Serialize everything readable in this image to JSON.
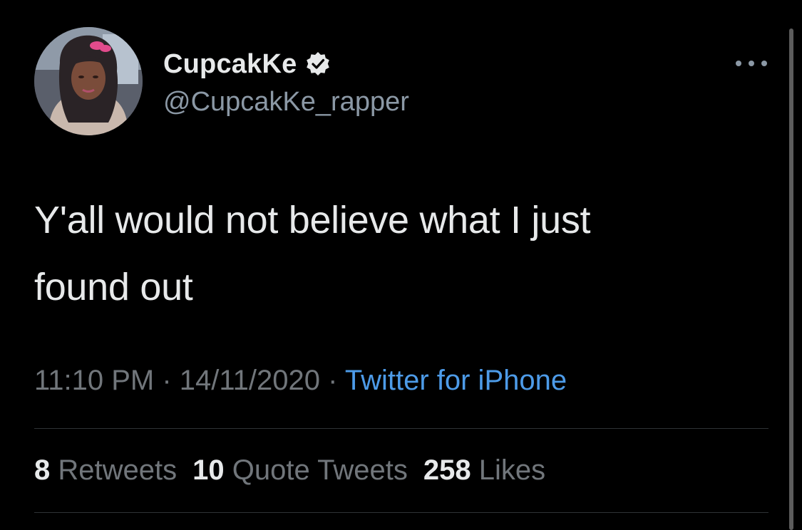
{
  "user": {
    "display_name": "CupcakKe",
    "handle": "@CupcakKe_rapper",
    "verified": true
  },
  "icons": {
    "verified": "verified-badge-icon",
    "more": "more-options-icon"
  },
  "tweet": {
    "text": "Y'all would not believe what I just\nfound out"
  },
  "meta": {
    "time": "11:10 PM",
    "separator": " · ",
    "date": "14/11/2020",
    "source": "Twitter for iPhone"
  },
  "stats": {
    "retweets_count": "8",
    "retweets_label": "Retweets",
    "quotes_count": "10",
    "quotes_label": "Quote Tweets",
    "likes_count": "258",
    "likes_label": "Likes"
  },
  "colors": {
    "background": "#000000",
    "primary_text": "#e7e9ea",
    "secondary_text": "#71767b",
    "link": "#4d9be8",
    "divider": "#2f3336"
  }
}
